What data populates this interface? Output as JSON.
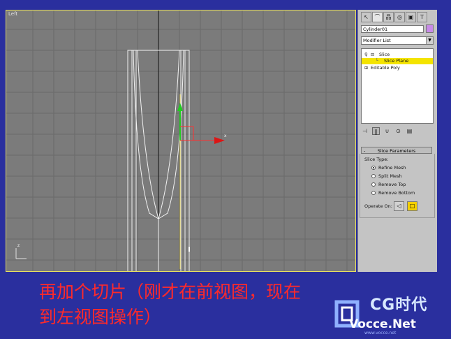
{
  "viewport": {
    "label": "Left",
    "axis_x": "x",
    "axis_y": "z"
  },
  "panel": {
    "tabs": [
      "↖",
      "⌒",
      "品",
      "◎",
      "▣",
      "T"
    ],
    "object_name": "Cylinder01",
    "modifier_list": "Modifier List",
    "stack": [
      {
        "label": "Slice",
        "icon": "bulb-icon"
      },
      {
        "label": "Slice Plane",
        "icon": ""
      },
      {
        "label": "Editable Poly",
        "icon": ""
      }
    ],
    "toolbar": [
      "⊣",
      "‖",
      "∪",
      "⊙",
      "▤"
    ],
    "rollout_title": "Slice Parameters",
    "slice_type_label": "Slice Type:",
    "options": [
      "Refine Mesh",
      "Split Mesh",
      "Remove Top",
      "Remove Bottom"
    ],
    "operate_on_label": "Operate On:"
  },
  "caption": {
    "line1": "再加个切片（刚才在前视图，现在",
    "line2": "到左视图操作）"
  },
  "logo": {
    "main": "CG时代",
    "sub": "Vocce.Net",
    "tiny": "www.vocce.net"
  },
  "colors": {
    "background": "#2a2f9e",
    "caption": "#ff2a2a",
    "highlight": "#f4e400"
  }
}
